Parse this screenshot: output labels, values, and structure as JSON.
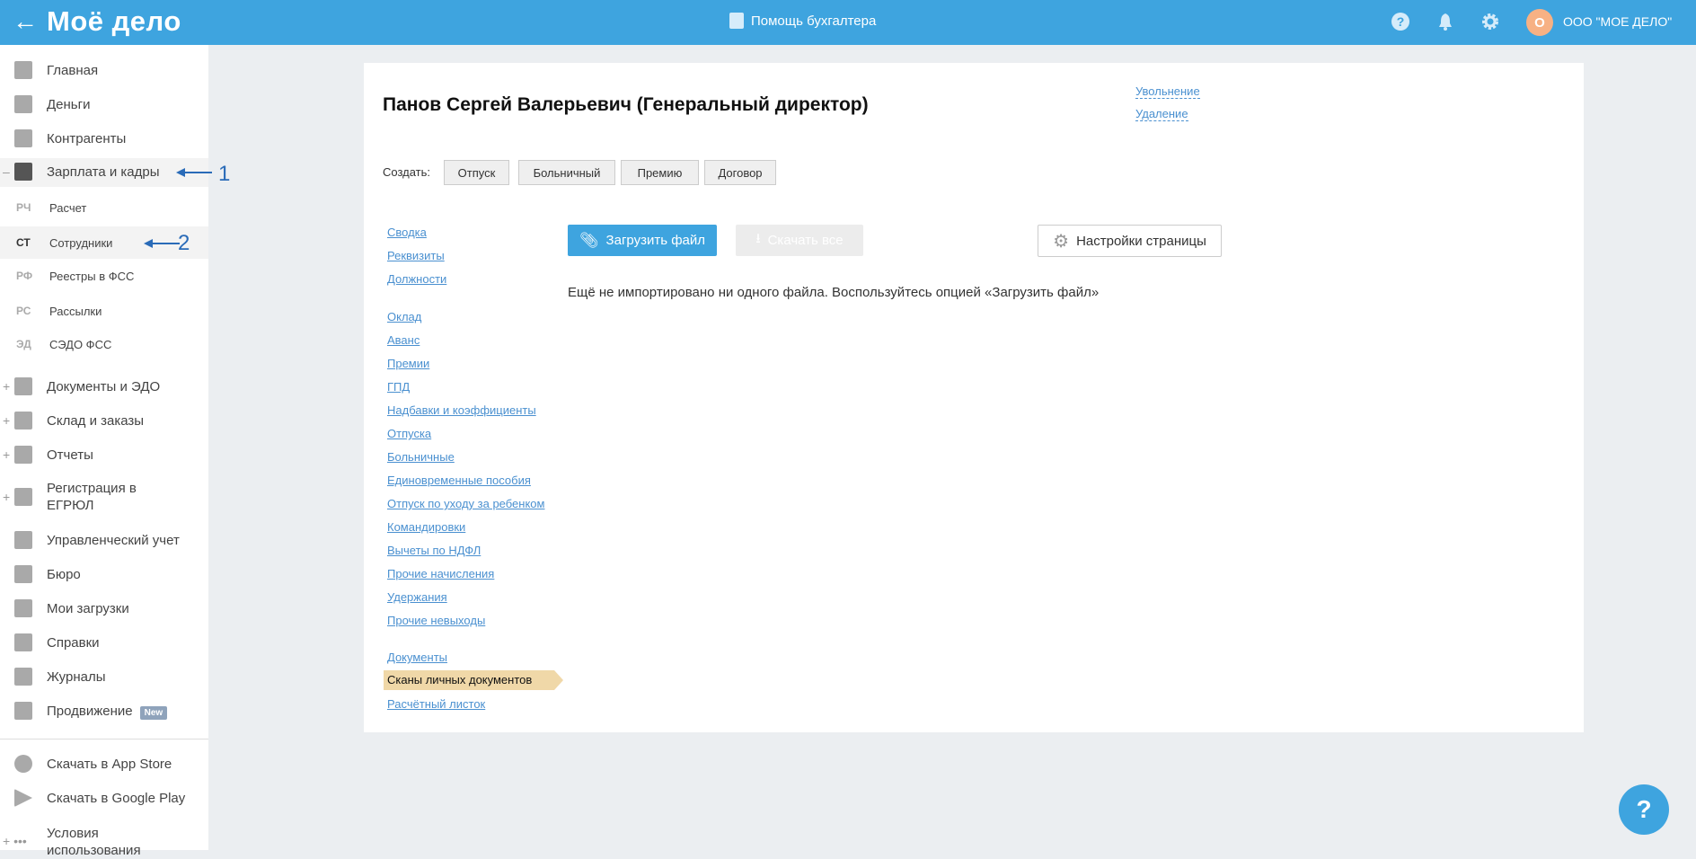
{
  "header": {
    "logo": "Моё дело",
    "help_accountant": "Помощь бухгалтера",
    "avatar_letter": "О",
    "org": "ООО \"МОЕ ДЕЛО\"",
    "back": "←"
  },
  "sidebar": {
    "items": [
      {
        "label": "Главная"
      },
      {
        "label": "Деньги"
      },
      {
        "label": "Контрагенты"
      },
      {
        "label": "Зарплата и кадры",
        "pm": "–"
      },
      {
        "abbr": "РЧ",
        "label": "Расчет"
      },
      {
        "abbr": "СТ",
        "label": "Сотрудники"
      },
      {
        "abbr": "РФ",
        "label": "Реестры в ФСС"
      },
      {
        "abbr": "РС",
        "label": "Рассылки"
      },
      {
        "abbr": "ЭД",
        "label": "СЭДО ФСС"
      },
      {
        "label": "Документы и ЭДО",
        "pm": "+"
      },
      {
        "label": "Склад и заказы",
        "pm": "+"
      },
      {
        "label": "Отчеты",
        "pm": "+"
      },
      {
        "label": "Регистрация в ЕГРЮЛ",
        "pm": "+"
      },
      {
        "label": "Управленческий учет"
      },
      {
        "label": "Бюро"
      },
      {
        "label": "Мои загрузки"
      },
      {
        "label": "Справки"
      },
      {
        "label": "Журналы"
      },
      {
        "label": "Продвижение",
        "badge": "New"
      },
      {
        "label": "Скачать в App Store"
      },
      {
        "label": "Скачать в Google Play"
      },
      {
        "label": "Условия использования",
        "pm": "+ •••"
      }
    ]
  },
  "annotations": [
    "1",
    "2"
  ],
  "employee": {
    "title": "Панов Сергей Валерьевич (Генеральный директор)",
    "dismiss": "Увольнение",
    "delete": "Удаление"
  },
  "create": {
    "label": "Создать:",
    "buttons": [
      "Отпуск",
      "Больничный",
      "Премию",
      "Договор"
    ]
  },
  "nav": [
    "Сводка",
    "Реквизиты",
    "Должности",
    "Оклад",
    "Аванс",
    "Премии",
    "ГПД",
    "Надбавки и коэффициенты",
    "Отпуска",
    "Больничные",
    "Единовременные пособия",
    "Отпуск по уходу за ребенком",
    "Командировки",
    "Вычеты по НДФЛ",
    "Прочие начисления",
    "Удержания",
    "Прочие невыходы",
    "Документы",
    "Сканы личных документов",
    "Расчётный листок"
  ],
  "toolbar": {
    "upload": "Загрузить файл",
    "download_all": "Скачать все",
    "settings": "Настройки страницы"
  },
  "message": "Ещё не импортировано ни одного файла. Воспользуйтесь опцией «Загрузить файл»",
  "fab": "?"
}
